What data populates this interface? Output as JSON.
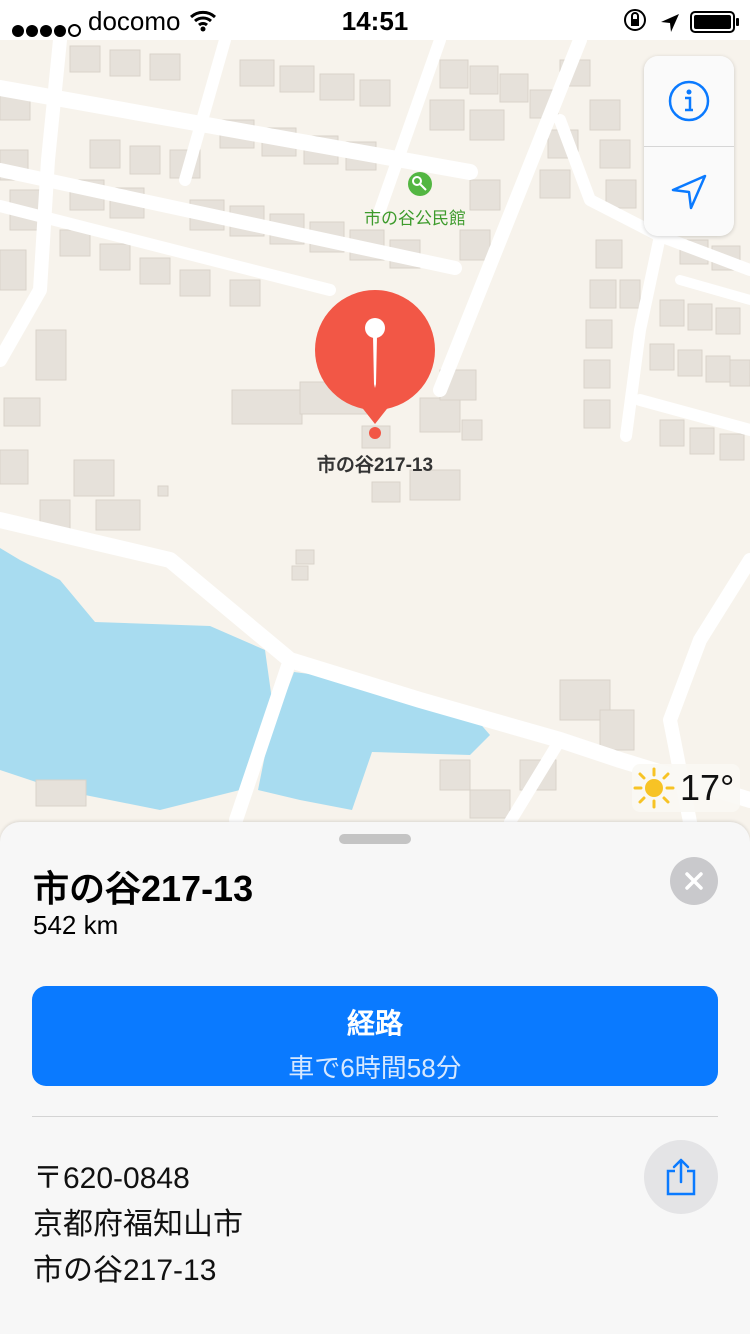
{
  "status_bar": {
    "carrier": "docomo",
    "time": "14:51"
  },
  "map": {
    "poi_label": "市の谷公民館",
    "pin_label": "市の谷217-13",
    "weather": {
      "temperature": "17°",
      "icon": "sun-icon"
    },
    "colors": {
      "land": "#f7f3ec",
      "water": "#a8dcf0",
      "pin": "#f25746",
      "poi_green": "#3d9b2c",
      "accent_blue": "#0a7aff"
    }
  },
  "sheet": {
    "title": "市の谷217-13",
    "distance": "542 km",
    "route": {
      "title": "経路",
      "subtitle": "車で6時間58分"
    },
    "address": {
      "postal": "〒620-0848",
      "line1": "京都府福知山市",
      "line2": "市の谷217-13"
    }
  }
}
